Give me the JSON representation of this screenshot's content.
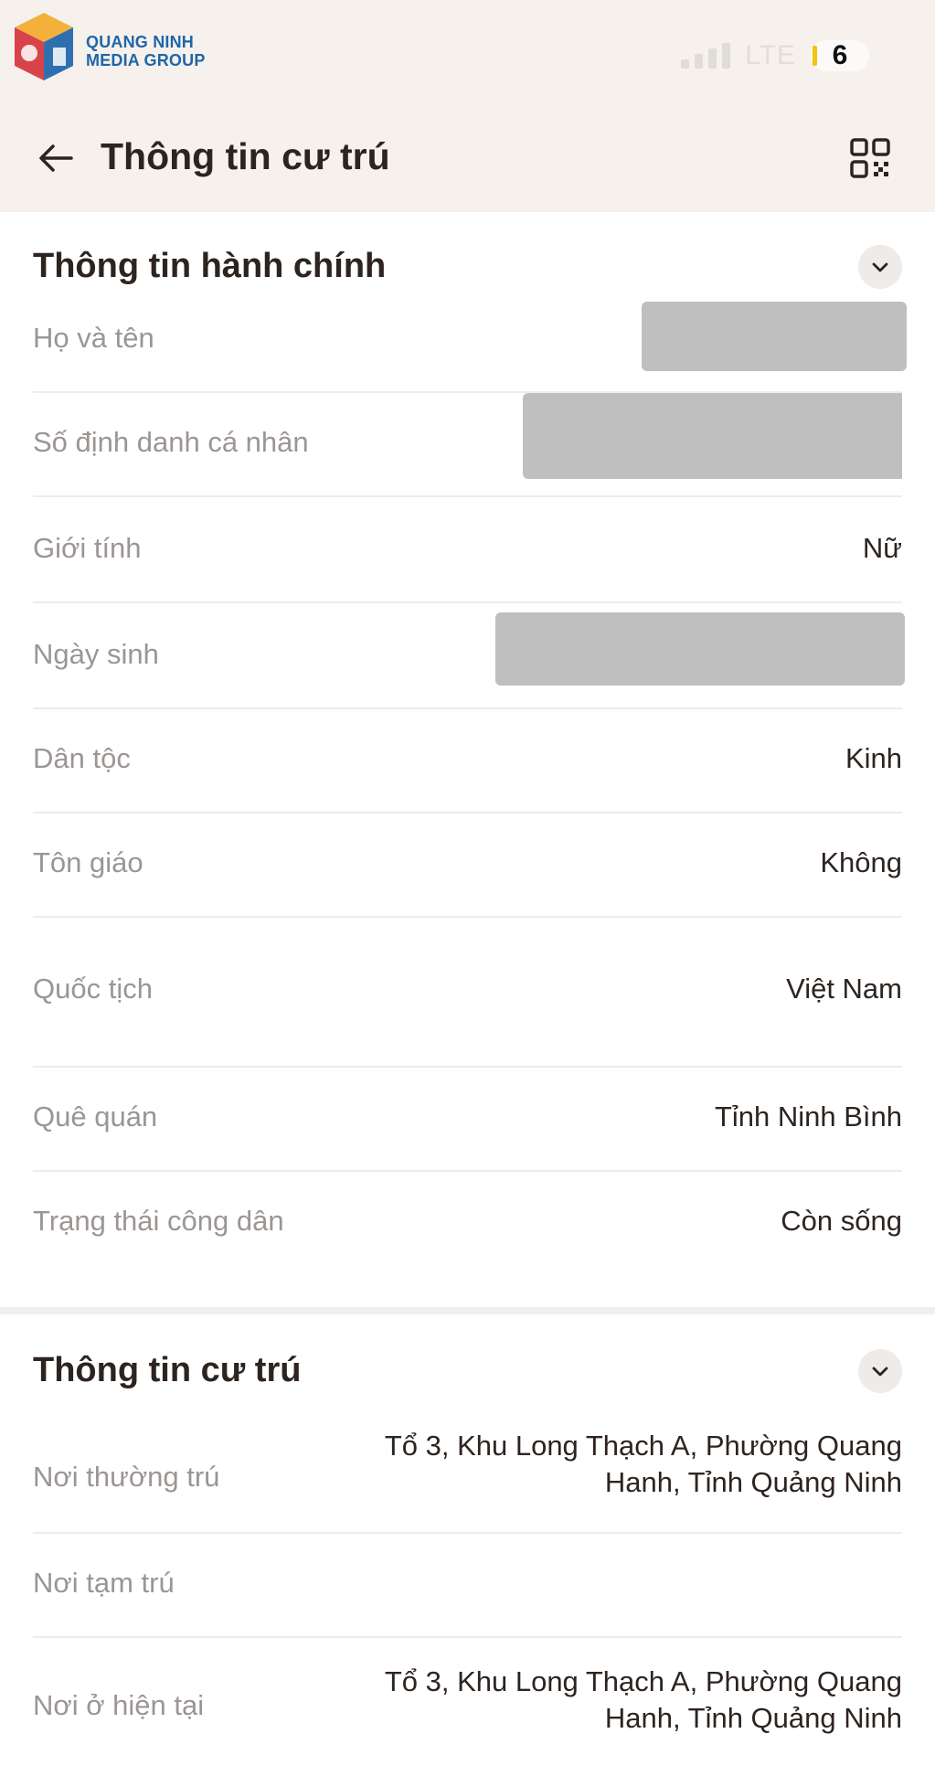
{
  "watermark": {
    "line1": "QUANG NINH",
    "line2": "MEDIA GROUP"
  },
  "status_bar": {
    "network": "LTE",
    "battery": "6"
  },
  "header": {
    "title": "Thông tin cư trú"
  },
  "admin_section": {
    "title": "Thông tin hành chính",
    "rows": [
      {
        "label": "Họ và tên",
        "value": ""
      },
      {
        "label": "Số định danh cá nhân",
        "value": ""
      },
      {
        "label": "Giới tính",
        "value": "Nữ"
      },
      {
        "label": "Ngày sinh",
        "value": ""
      },
      {
        "label": "Dân tộc",
        "value": "Kinh"
      },
      {
        "label": "Tôn giáo",
        "value": "Không"
      },
      {
        "label": "Quốc tịch",
        "value": "Việt Nam"
      },
      {
        "label": "Quê quán",
        "value": "Tỉnh Ninh Bình"
      },
      {
        "label": "Trạng thái công dân",
        "value": "Còn sống"
      }
    ]
  },
  "residence_section": {
    "title": "Thông tin cư trú",
    "rows": [
      {
        "label": "Nơi thường trú",
        "value_line1": "Tổ 3, Khu Long Thạch A, Phường Quang",
        "value_line2": "Hanh, Tỉnh Quảng Ninh"
      },
      {
        "label": "Nơi tạm trú",
        "value_line1": "",
        "value_line2": ""
      },
      {
        "label": "Nơi ở hiện tại",
        "value_line1": "Tổ 3, Khu Long Thạch A, Phường Quang",
        "value_line2": "Hanh, Tỉnh Quảng Ninh"
      }
    ]
  }
}
